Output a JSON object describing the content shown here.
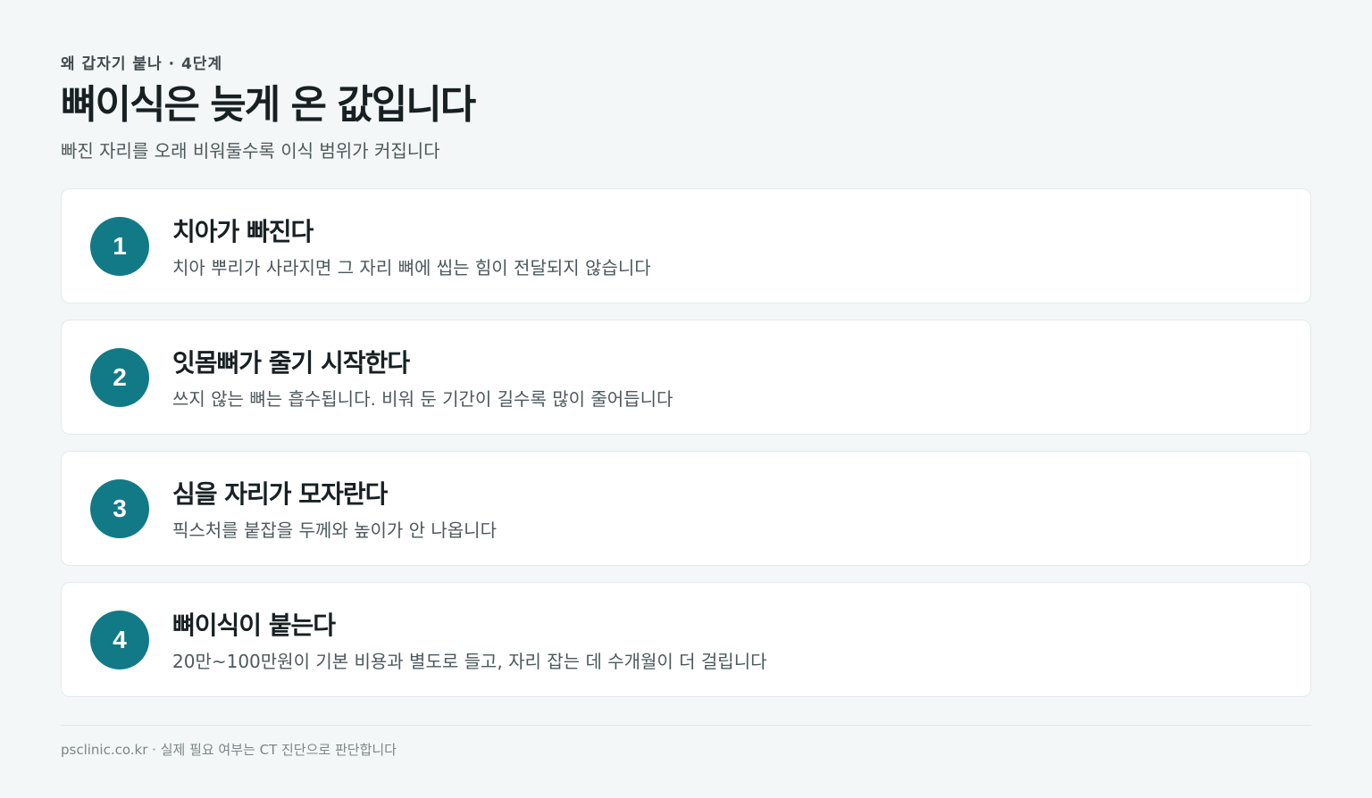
{
  "header": {
    "eyebrow": "왜 갑자기 붙나 · 4단계",
    "title": "뼈이식은 늦게 온 값입니다",
    "subtitle": "빠진 자리를 오래 비워둘수록 이식 범위가 커집니다"
  },
  "steps": [
    {
      "number": "1",
      "title": "치아가 빠진다",
      "description": "치아 뿌리가 사라지면 그 자리 뼈에 씹는 힘이 전달되지 않습니다"
    },
    {
      "number": "2",
      "title": "잇몸뼈가 줄기 시작한다",
      "description": "쓰지 않는 뼈는 흡수됩니다. 비워 둔 기간이 길수록 많이 줄어듭니다"
    },
    {
      "number": "3",
      "title": "심을 자리가 모자란다",
      "description": "픽스처를 붙잡을 두께와 높이가 안 나옵니다"
    },
    {
      "number": "4",
      "title": "뼈이식이 붙는다",
      "description": "20만~100만원이 기본 비용과 별도로 들고, 자리 잡는 데 수개월이 더 걸립니다"
    }
  ],
  "footer": {
    "text": "psclinic.co.kr · 실제 필요 여부는 CT 진단으로 판단합니다"
  },
  "colors": {
    "accent": "#127a86",
    "background": "#f4f7f7",
    "card": "#ffffff"
  }
}
